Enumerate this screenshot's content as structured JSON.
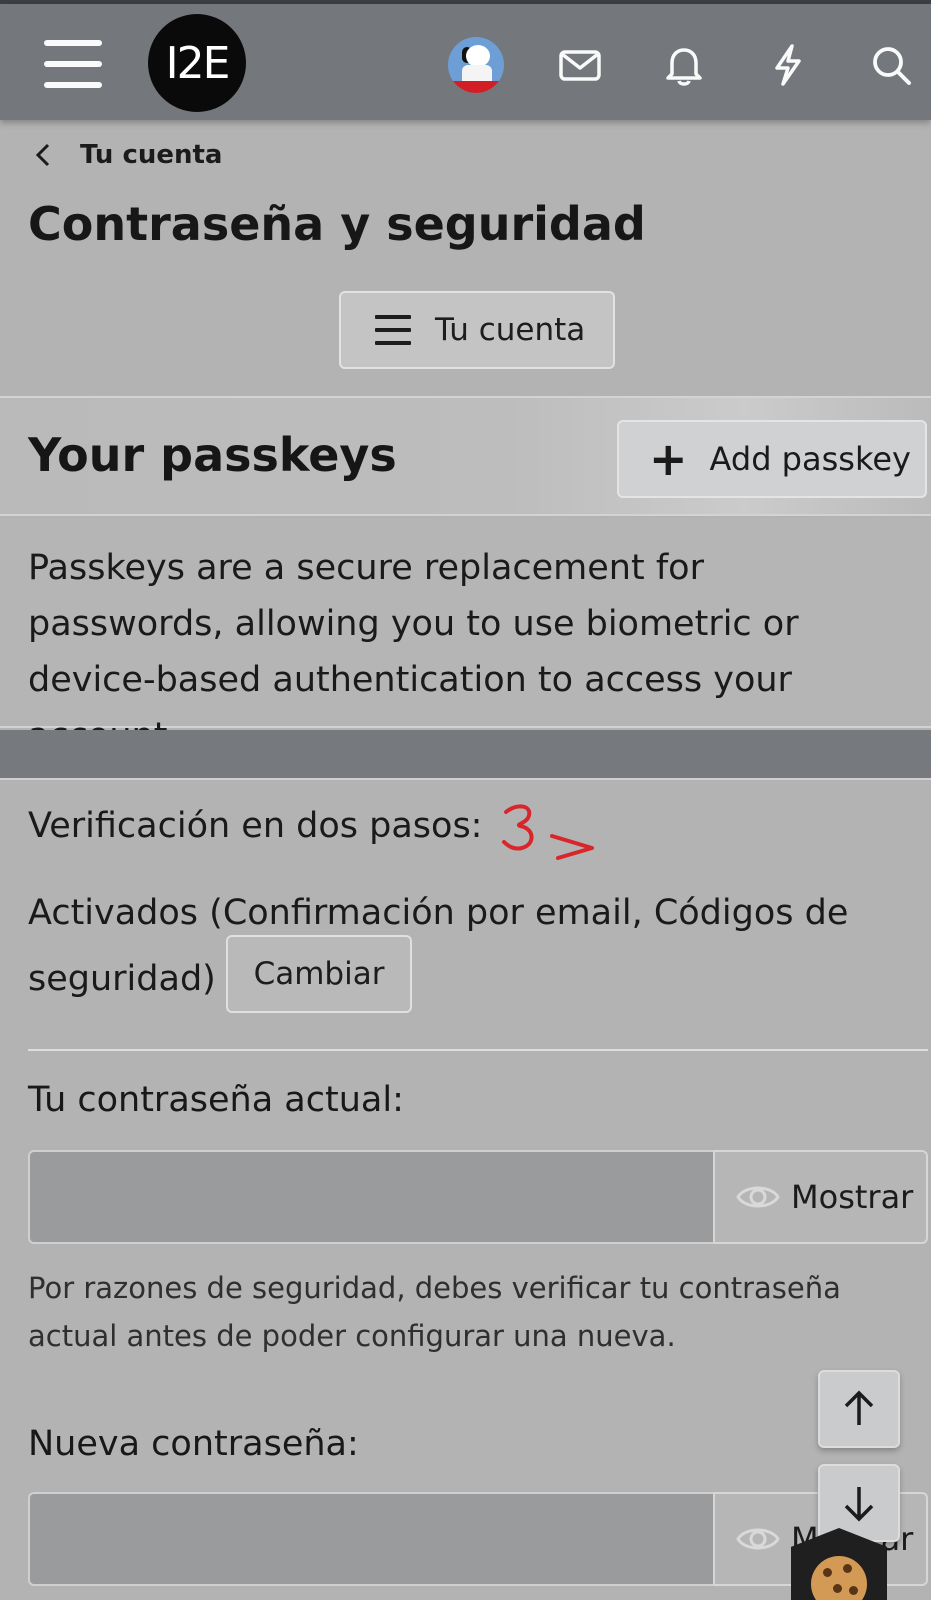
{
  "header": {
    "logo_text": "I2E",
    "icons": [
      "menu-icon",
      "avatar",
      "mail-icon",
      "bell-icon",
      "lightning-icon",
      "search-icon"
    ]
  },
  "breadcrumb": {
    "label": "Tu cuenta"
  },
  "page": {
    "title": "Contraseña y seguridad",
    "account_menu_button": "Tu cuenta"
  },
  "passkeys": {
    "title": "Your passkeys",
    "add_button": "Add passkey",
    "description": "Passkeys are a secure replacement for passwords, allowing you to use biometric or device-based authentication to access your account."
  },
  "two_step": {
    "label": "Verificación en dos pasos:",
    "status": "Activados (Confirmación por email, Códigos de seguridad)",
    "change_button": "Cambiar",
    "annotation": "3>"
  },
  "current_password": {
    "label": "Tu contraseña actual:",
    "value": "",
    "show_button": "Mostrar",
    "hint": "Por razones de seguridad, debes verificar tu contraseña actual antes de poder configurar una nueva."
  },
  "new_password": {
    "label": "Nueva contraseña:",
    "value": "",
    "show_button": "Mostrar"
  },
  "colors": {
    "appbar": "#74787d",
    "background": "#b3b3b3",
    "band": "#76797d"
  }
}
